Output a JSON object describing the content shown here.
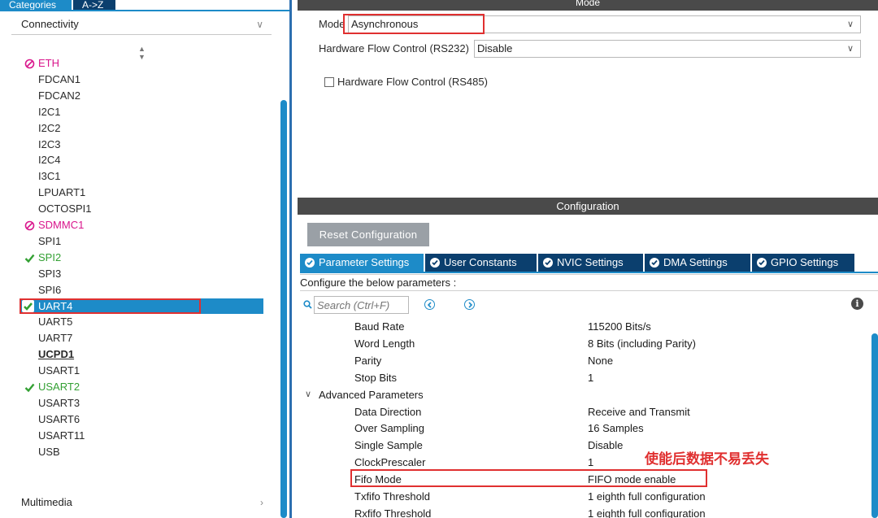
{
  "left_tabs": {
    "categories": "Categories",
    "az": "A->Z"
  },
  "groups": {
    "connectivity": "Connectivity",
    "multimedia": "Multimedia"
  },
  "peripherals": [
    {
      "label": "ETH",
      "status": "disabled"
    },
    {
      "label": "FDCAN1",
      "status": "none"
    },
    {
      "label": "FDCAN2",
      "status": "none"
    },
    {
      "label": "I2C1",
      "status": "none"
    },
    {
      "label": "I2C2",
      "status": "none"
    },
    {
      "label": "I2C3",
      "status": "none"
    },
    {
      "label": "I2C4",
      "status": "none"
    },
    {
      "label": "I3C1",
      "status": "none"
    },
    {
      "label": "LPUART1",
      "status": "none"
    },
    {
      "label": "OCTOSPI1",
      "status": "none"
    },
    {
      "label": "SDMMC1",
      "status": "disabled"
    },
    {
      "label": "SPI1",
      "status": "none"
    },
    {
      "label": "SPI2",
      "status": "ok"
    },
    {
      "label": "SPI3",
      "status": "none"
    },
    {
      "label": "SPI6",
      "status": "none"
    },
    {
      "label": "UART4",
      "status": "selected"
    },
    {
      "label": "UART5",
      "status": "none"
    },
    {
      "label": "UART7",
      "status": "none"
    },
    {
      "label": "UCPD1",
      "status": "bold"
    },
    {
      "label": "USART1",
      "status": "none"
    },
    {
      "label": "USART2",
      "status": "ok"
    },
    {
      "label": "USART3",
      "status": "none"
    },
    {
      "label": "USART6",
      "status": "none"
    },
    {
      "label": "USART11",
      "status": "none"
    },
    {
      "label": "USB",
      "status": "none"
    }
  ],
  "mode_section": {
    "header": "Mode",
    "mode_label": "Mode",
    "mode_value": "Asynchronous",
    "flow232_label": "Hardware Flow Control (RS232)",
    "flow232_value": "Disable",
    "flow485_label": "Hardware Flow Control (RS485)",
    "flow485_checked": false
  },
  "config_section": {
    "header": "Configuration",
    "reset_button": "Reset Configuration",
    "tabs": [
      "Parameter Settings",
      "User Constants",
      "NVIC Settings",
      "DMA Settings",
      "GPIO Settings"
    ],
    "active_tab": "Parameter Settings",
    "configure_text": "Configure the below parameters :",
    "search_placeholder": "Search (Ctrl+F)"
  },
  "parameters": [
    {
      "name": "Baud Rate",
      "value": "115200 Bits/s"
    },
    {
      "name": "Word Length",
      "value": "8 Bits (including Parity)"
    },
    {
      "name": "Parity",
      "value": "None"
    },
    {
      "name": "Stop Bits",
      "value": "1"
    },
    {
      "name": "Advanced Parameters",
      "value": "",
      "group": true
    },
    {
      "name": "Data Direction",
      "value": "Receive and Transmit"
    },
    {
      "name": "Over Sampling",
      "value": "16 Samples"
    },
    {
      "name": "Single Sample",
      "value": "Disable"
    },
    {
      "name": "ClockPrescaler",
      "value": "1"
    },
    {
      "name": "Fifo Mode",
      "value": "FIFO mode enable"
    },
    {
      "name": "Txfifo Threshold",
      "value": "1 eighth full configuration"
    },
    {
      "name": "Rxfifo Threshold",
      "value": "1 eighth full configuration"
    }
  ],
  "annotation": "使能后数据不易丢失",
  "colors": {
    "accent": "#1d8bc8",
    "dark_tab": "#0b3f6e",
    "header_bar": "#4a4a4a",
    "highlight": "#e03030",
    "ok": "#33a033",
    "disabled": "#d9168c"
  }
}
